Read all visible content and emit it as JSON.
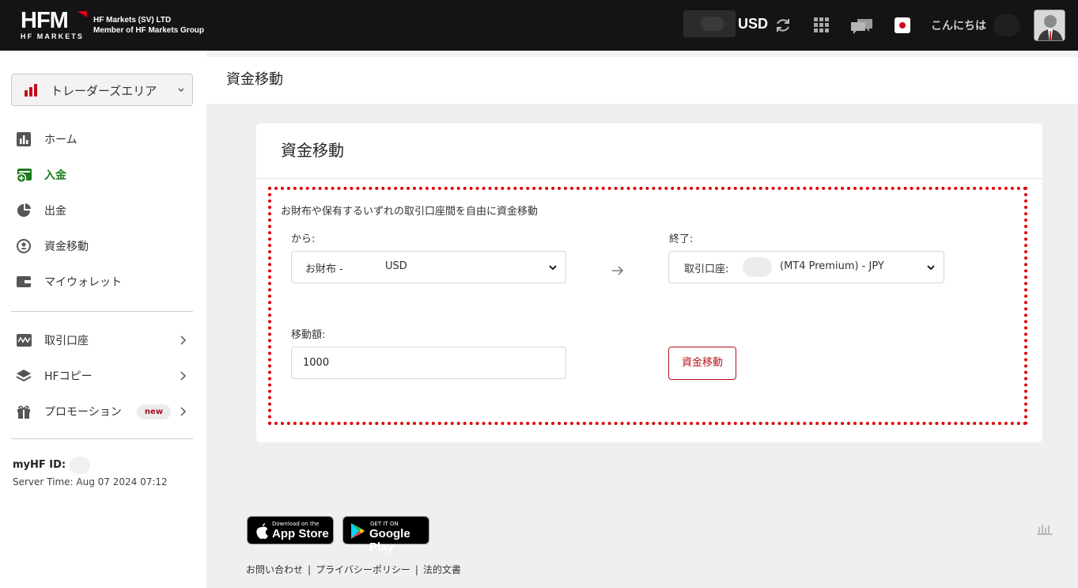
{
  "header": {
    "logo_text": "HFM",
    "logo_subtext": "HF MARKETS",
    "company_line1": "HF Markets (SV) LTD",
    "company_line2": "Member of HF Markets Group",
    "currency": "USD",
    "greeting": "こんにちは"
  },
  "sidebar": {
    "area_select": "トレーダーズエリア",
    "items": [
      {
        "label": "ホーム",
        "icon": "chart-icon"
      },
      {
        "label": "入金",
        "icon": "deposit-icon"
      },
      {
        "label": "出金",
        "icon": "withdraw-icon"
      },
      {
        "label": "資金移動",
        "icon": "transfer-icon"
      },
      {
        "label": "マイウォレット",
        "icon": "wallet-icon"
      }
    ],
    "items2": [
      {
        "label": "取引口座",
        "icon": "trading-account-icon"
      },
      {
        "label": "HFコピー",
        "icon": "layers-icon"
      },
      {
        "label": "プロモーション",
        "icon": "gift-icon",
        "badge": "new"
      }
    ],
    "myhf_label": "myHF ID:",
    "server_time": "Server Time: Aug 07 2024 07:12"
  },
  "page": {
    "title": "資金移動"
  },
  "card": {
    "title": "資金移動",
    "description": "お財布や保有するいずれの取引口座間を自由に資金移動",
    "from_label": "から:",
    "from_value_prefix": "お財布 -",
    "from_value_currency": "USD",
    "to_label": "終了:",
    "to_value_prefix": "取引口座:",
    "to_value_suffix": "(MT4 Premium) - JPY",
    "amount_label": "移動額:",
    "amount_value": "1000",
    "submit_label": "資金移動"
  },
  "footer": {
    "appstore_small": "Download on the",
    "appstore_big": "App Store",
    "googleplay_small": "GET IT ON",
    "googleplay_big": "Google Play",
    "links": [
      "お問い合わせ",
      "プライバシーポリシー",
      "法的文書"
    ]
  },
  "colors": {
    "brand_red": "#b5121b",
    "active_green": "#1a7a1a",
    "highlight_dotted": "#e00000"
  }
}
